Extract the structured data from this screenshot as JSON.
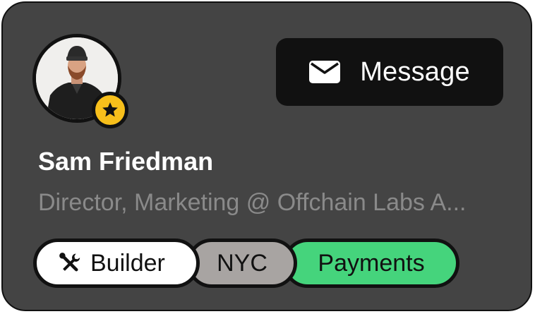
{
  "profile": {
    "name": "Sam Friedman",
    "title": "Director, Marketing @ Offchain Labs A..."
  },
  "actions": {
    "message_label": "Message"
  },
  "tags": [
    {
      "label": "Builder",
      "icon": "tools-icon",
      "color": "#ffffff"
    },
    {
      "label": "NYC",
      "color": "#a8a4a2"
    },
    {
      "label": "Payments",
      "color": "#45d47c"
    }
  ],
  "badges": {
    "star": {
      "icon": "star-icon",
      "color": "#f7bf1b"
    }
  },
  "colors": {
    "card_bg": "#444444",
    "button_bg": "#111111"
  }
}
